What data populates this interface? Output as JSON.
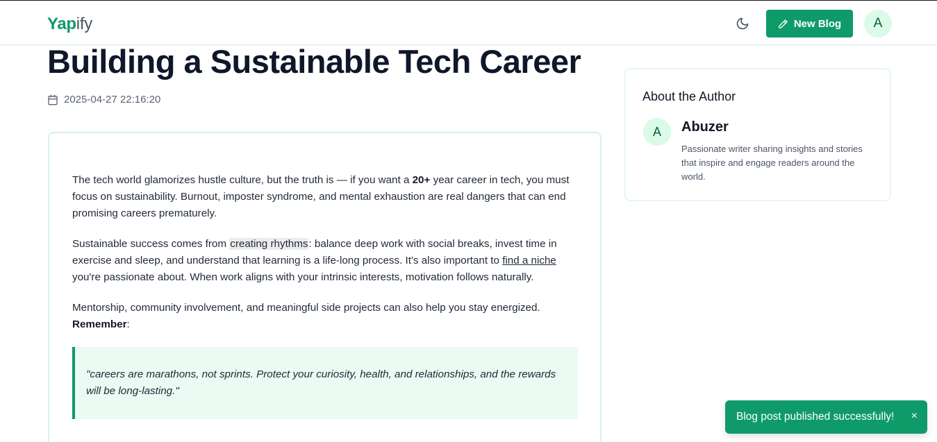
{
  "header": {
    "logo_strong": "Yap",
    "logo_light": "ify",
    "new_blog_label": "New Blog",
    "avatar_initial": "A",
    "icons": {
      "theme": "moon-icon",
      "edit": "pencil-icon"
    }
  },
  "post": {
    "title": "Building a Sustainable Tech Career",
    "date": "2025-04-27 22:16:20",
    "p1_a": "The tech world glamorizes hustle culture, but the truth is — if you want a ",
    "p1_bold": "20+",
    "p1_b": " year career in tech, you must focus on sustainability. Burnout, imposter syndrome, and mental exhaustion are real dangers that can end promising careers prematurely.",
    "p2_a": "Sustainable success comes from ",
    "p2_highlight": "creating rhythms",
    "p2_b": ": balance deep work with social breaks, invest time in exercise and sleep, and understand that learning is a life-long process. It's also important to ",
    "p2_link": "find a niche",
    "p2_c": " you're passionate about. When work aligns with your intrinsic interests, motivation follows naturally.",
    "p3_a": "Mentorship, community involvement, and meaningful side projects can also help you stay energized. ",
    "p3_bold": "Remember",
    "p3_b": ":",
    "quote": "\"careers are marathons, not sprints. Protect your curiosity, health, and relationships, and the rewards will be long-lasting.\""
  },
  "author": {
    "heading": "About the Author",
    "initial": "A",
    "name": "Abuzer",
    "bio": "Passionate writer sharing insights and stories that inspire and engage readers around the world."
  },
  "toast": {
    "message": "Blog post published successfully!",
    "close": "×"
  },
  "colors": {
    "brand": "#0f9a6a",
    "avatar_bg": "#d9fbe8",
    "quote_bg": "#ebfaf2"
  }
}
